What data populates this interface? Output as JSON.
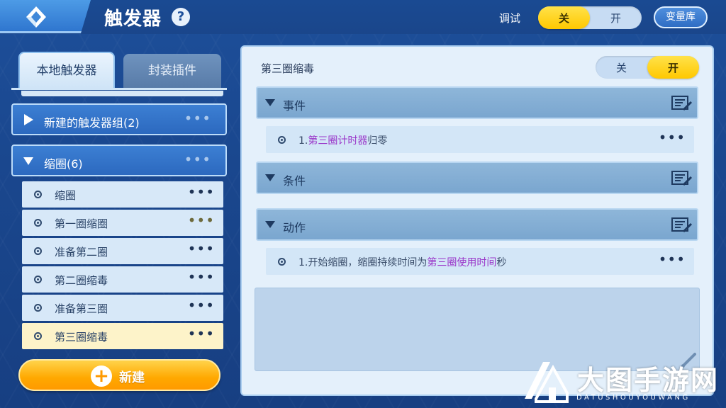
{
  "header": {
    "title": "触发器",
    "help_symbol": "?",
    "debug_label": "调试",
    "debug_toggle": {
      "off_label": "关",
      "on_label": "开",
      "selected": "off"
    },
    "variable_library_label": "变量库"
  },
  "sidebar": {
    "tabs": [
      {
        "label": "本地触发器",
        "active": true
      },
      {
        "label": "封装插件",
        "active": false
      }
    ],
    "groups": [
      {
        "label": "新建的触发器组(2)",
        "expanded": false,
        "more": "•••"
      },
      {
        "label": "缩圈(6)",
        "expanded": true,
        "more": "•••"
      }
    ],
    "items": [
      {
        "label": "缩圈",
        "more": "•••"
      },
      {
        "label": "第一圈缩圈",
        "more": "•••"
      },
      {
        "label": "准备第二圈",
        "more": "•••"
      },
      {
        "label": "第二圈缩毒",
        "more": "•••"
      },
      {
        "label": "准备第三圈",
        "more": "•••"
      },
      {
        "label": "第三圈缩毒",
        "more": "•••",
        "selected": true
      }
    ],
    "new_button_label": "新建",
    "new_button_symbol": "+"
  },
  "editor": {
    "trigger_name": "第三圈缩毒",
    "enable_toggle": {
      "off_label": "关",
      "on_label": "开",
      "selected": "on"
    },
    "sections": [
      {
        "label": "事件"
      },
      {
        "label": "条件"
      },
      {
        "label": "动作"
      }
    ],
    "event_row": {
      "prefix": "1.",
      "highlight": "第三圈计时器",
      "suffix": "归零",
      "more": "•••"
    },
    "action_row": {
      "prefix": "1.开始缩圈，缩圈持续时间为",
      "highlight": "第三圈使用时间",
      "suffix": "秒",
      "more": "•••"
    }
  },
  "watermark": {
    "title": "大图手游网",
    "subtitle": "DATUSHOUYOUWANG"
  },
  "colors": {
    "accent_yellow": "#ffc800",
    "header_blue": "#1a4a92",
    "highlight_purple": "#9a36c9",
    "new_button_orange": "#ffa800"
  }
}
